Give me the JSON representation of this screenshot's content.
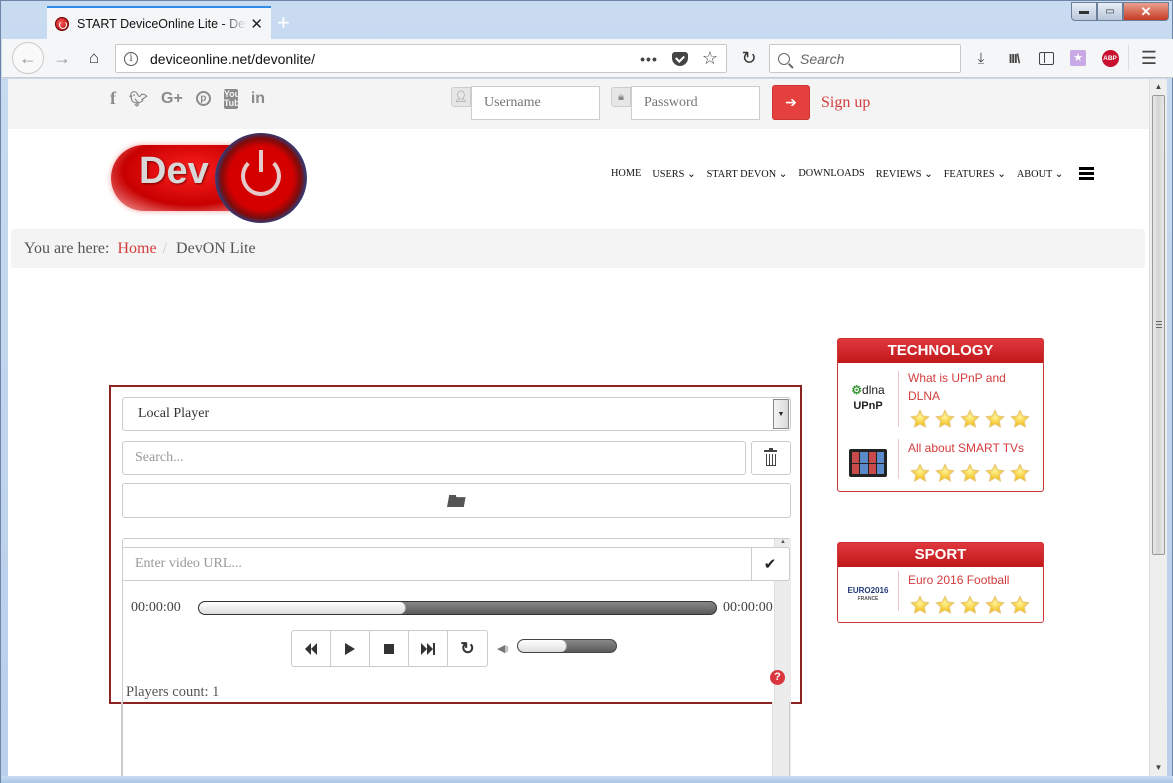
{
  "browser": {
    "tab": {
      "title": "START DeviceOnline Lite - DeviceOnline",
      "close_glyph": "✕"
    },
    "new_tab_glyph": "+",
    "window_controls": {
      "minimize": "▬",
      "maximize": "▭",
      "close": "✕"
    },
    "nav": {
      "back_glyph": "←",
      "forward_glyph": "→",
      "home_glyph": "⌂",
      "reload_glyph": "↻"
    },
    "url": "deviceonline.net/devonlite/",
    "url_actions": {
      "more": "•••",
      "bookmark": "☆"
    },
    "search_placeholder": "Search",
    "toolbar": {
      "download": "⤓",
      "library": "III\\",
      "ext": "★",
      "abp": "ABP",
      "menu": "☰"
    }
  },
  "topbar": {
    "social": [
      {
        "name": "facebook",
        "glyph": "f"
      },
      {
        "name": "twitter",
        "glyph": "🐦"
      },
      {
        "name": "google-plus",
        "glyph": "G+"
      },
      {
        "name": "pinterest",
        "glyph": "p"
      },
      {
        "name": "youtube",
        "glyph": "You Tube"
      },
      {
        "name": "linkedin",
        "glyph": "in"
      }
    ],
    "username_placeholder": "Username",
    "password_placeholder": "Password",
    "login_glyph": "➔",
    "signup_label": "Sign up"
  },
  "header": {
    "logo_text": "Dev",
    "nav": [
      "HOME",
      "USERS ⌄",
      "START DEVON ⌄",
      "DOWNLOADS",
      "REVIEWS ⌄",
      "FEATURES ⌄",
      "ABOUT ⌄"
    ]
  },
  "breadcrumb": {
    "prefix": "You are here:",
    "home": "Home",
    "separator": "/",
    "current": "DevON Lite"
  },
  "player": {
    "selected_player": "Local Player",
    "search_placeholder": "Search...",
    "url_placeholder": "Enter video URL...",
    "url_ok_glyph": "✔",
    "current_time": "00:00:00",
    "duration": "00:00:00",
    "progress_percent": 40,
    "volume_percent": 50,
    "volume_glyph": "🔈",
    "reload_glyph": "↻",
    "players_count": "Players count: 1",
    "help_glyph": "?"
  },
  "sidebar": {
    "widgets": [
      {
        "title": "TECHNOLOGY",
        "items": [
          {
            "title": "What is UPnP and DLNA",
            "thumb": "dlna-upnp",
            "rating": 5,
            "thumb_text": [
              "dlna",
              "UPnP"
            ]
          },
          {
            "title": "All about SMART TVs",
            "thumb": "smart-tv",
            "rating": 5
          }
        ]
      },
      {
        "title": "SPORT",
        "items": [
          {
            "title": "Euro 2016 Football",
            "thumb": "euro2016",
            "rating": 5,
            "thumb_text": [
              "EURO2016",
              "FRANCE"
            ]
          }
        ]
      }
    ]
  },
  "colors": {
    "accent_red": "#d33c3c",
    "panel_border": "#8b2323",
    "widget_header": "#c0171b",
    "login_button": "#e4403d"
  }
}
